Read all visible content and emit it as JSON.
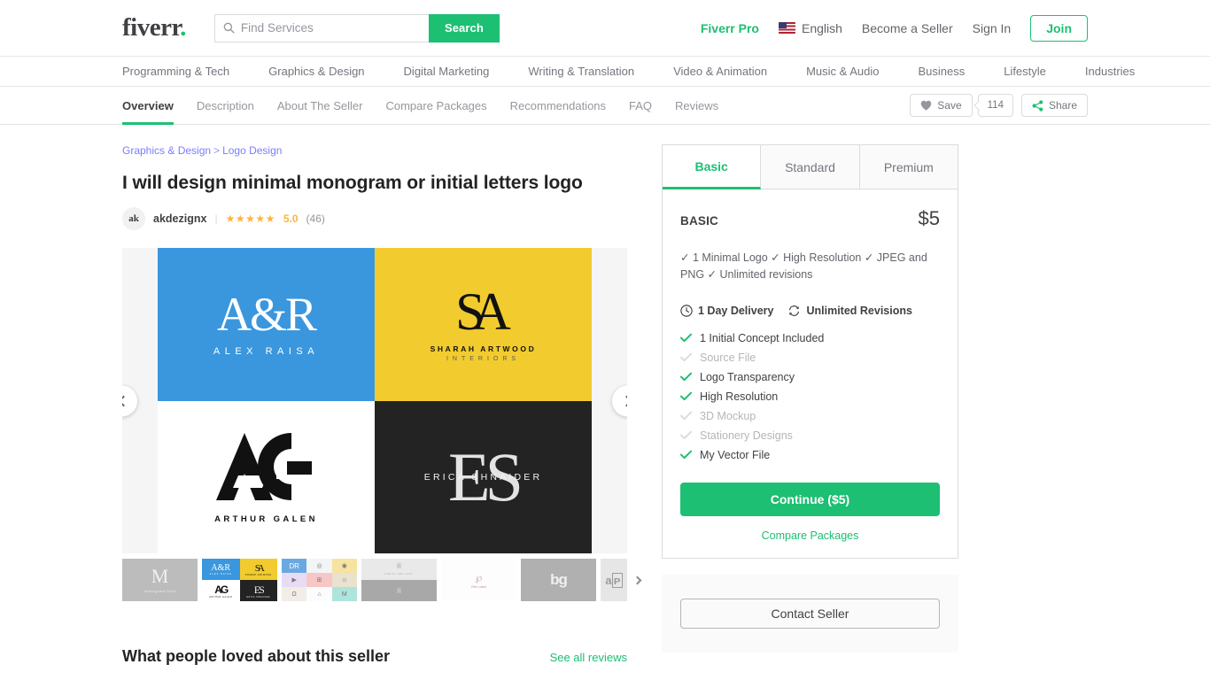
{
  "header": {
    "logo": "fiverr",
    "logo_dot": ".",
    "search": {
      "placeholder": "Find Services",
      "value": "",
      "button_label": "Search",
      "icon": "search-icon"
    },
    "pro_label": "Fiverr Pro",
    "language": "English",
    "flag_icon": "us-flag-icon",
    "become_seller": "Become a Seller",
    "sign_in": "Sign In",
    "join": "Join"
  },
  "category_nav": [
    "Programming & Tech",
    "Graphics & Design",
    "Digital Marketing",
    "Writing & Translation",
    "Video & Animation",
    "Music & Audio",
    "Business",
    "Lifestyle",
    "Industries"
  ],
  "gig_nav": {
    "tabs": [
      {
        "label": "Overview",
        "active": true
      },
      {
        "label": "Description",
        "active": false
      },
      {
        "label": "About The Seller",
        "active": false
      },
      {
        "label": "Compare Packages",
        "active": false
      },
      {
        "label": "Recommendations",
        "active": false
      },
      {
        "label": "FAQ",
        "active": false
      },
      {
        "label": "Reviews",
        "active": false
      }
    ],
    "save_label": "Save",
    "save_icon": "heart-icon",
    "save_count": "114",
    "share_label": "Share",
    "share_icon": "share-icon"
  },
  "breadcrumb": {
    "parent": "Graphics & Design",
    "separator": ">",
    "child": "Logo Design"
  },
  "gig": {
    "title": "I will design minimal monogram or initial letters logo",
    "seller_name": "akdezignx",
    "avatar_text": "ak",
    "stars": "★★★★★",
    "rating": "5.0",
    "rating_count": "(46)"
  },
  "gallery": {
    "prev_icon": "chevron-left-icon",
    "next_icon": "chevron-right-icon",
    "slide": {
      "quadrants": [
        {
          "name": "A&R",
          "mono": "A&R",
          "sub": "ALEX RAISA",
          "bg": "#3a97dd",
          "fg": "#ffffff"
        },
        {
          "name": "SA",
          "mono": "SA",
          "sub": "SHARAH ARTWOOD",
          "sub2": "INTERIORS",
          "bg": "#f2cb2e",
          "fg": "#111111"
        },
        {
          "name": "AG",
          "mono": "AG",
          "sub": "ARTHUR GALEN",
          "bg": "#ffffff",
          "fg": "#111111"
        },
        {
          "name": "ES",
          "mono": "ES",
          "sub": "ERICA SHNAIDER",
          "bg": "#232323",
          "fg": "#f2f2f2"
        }
      ]
    },
    "thumbnails": [
      {
        "label": "M",
        "sub": "monogram folio",
        "type": "mono-m"
      },
      {
        "label": "quad-logos",
        "type": "quad",
        "selected": false
      },
      {
        "label": "logo-grid-9",
        "type": "grid9"
      },
      {
        "label": "christ-her-lady",
        "type": "gray-wide"
      },
      {
        "label": "pink-label",
        "type": "pink-mono"
      },
      {
        "label": "bg",
        "type": "bg-mono"
      },
      {
        "label": "ap",
        "type": "ap-mono"
      }
    ],
    "thumbs_next_icon": "chevron-right-icon"
  },
  "packages": {
    "tabs": [
      {
        "label": "Basic",
        "active": true
      },
      {
        "label": "Standard",
        "active": false
      },
      {
        "label": "Premium",
        "active": false
      }
    ],
    "name": "BASIC",
    "price": "$5",
    "description": "✓ 1 Minimal Logo ✓ High Resolution ✓ JPEG and PNG ✓ Unlimited revisions",
    "delivery": "1 Day Delivery",
    "delivery_icon": "clock-icon",
    "revisions": "Unlimited Revisions",
    "revisions_icon": "refresh-icon",
    "features": [
      {
        "label": "1 Initial Concept Included",
        "included": true
      },
      {
        "label": "Source File",
        "included": false
      },
      {
        "label": "Logo Transparency",
        "included": true
      },
      {
        "label": "High Resolution",
        "included": true
      },
      {
        "label": "3D Mockup",
        "included": false
      },
      {
        "label": "Stationery Designs",
        "included": false
      },
      {
        "label": "My Vector File",
        "included": true
      }
    ],
    "continue_label": "Continue ($5)",
    "compare_label": "Compare Packages",
    "contact_label": "Contact Seller"
  },
  "reviews_section": {
    "title": "What people loved about this seller",
    "see_all": "See all reviews"
  }
}
